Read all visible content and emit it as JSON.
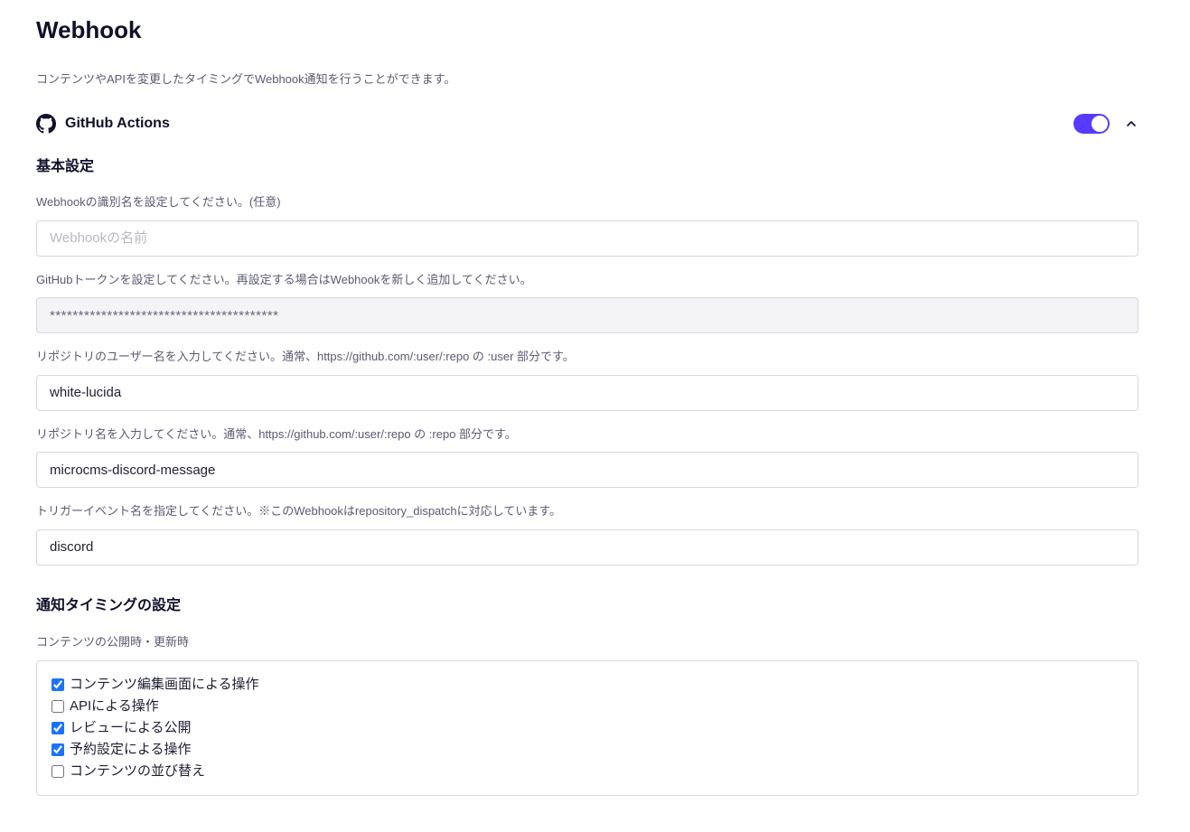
{
  "page": {
    "title": "Webhook",
    "description": "コンテンツやAPIを変更したタイミングでWebhook通知を行うことができます。"
  },
  "integration": {
    "name": "GitHub Actions",
    "enabled": true
  },
  "basic": {
    "title": "基本設定",
    "fields": {
      "name": {
        "label": "Webhookの識別名を設定してください。(任意)",
        "placeholder": "Webhookの名前",
        "value": ""
      },
      "token": {
        "label": "GitHubトークンを設定してください。再設定する場合はWebhookを新しく追加してください。",
        "value": "****************************************"
      },
      "user": {
        "label": "リポジトリのユーザー名を入力してください。通常、https://github.com/:user/:repo の :user 部分です。",
        "value": "white-lucida"
      },
      "repo": {
        "label": "リポジトリ名を入力してください。通常、https://github.com/:user/:repo の :repo 部分です。",
        "value": "microcms-discord-message"
      },
      "event": {
        "label": "トリガーイベント名を指定してください。※このWebhookはrepository_dispatchに対応しています。",
        "value": "discord"
      }
    }
  },
  "timing": {
    "title": "通知タイミングの設定",
    "group_label": "コンテンツの公開時・更新時",
    "items": [
      {
        "label": "コンテンツ編集画面による操作",
        "checked": true
      },
      {
        "label": "APIによる操作",
        "checked": false
      },
      {
        "label": "レビューによる公開",
        "checked": true
      },
      {
        "label": "予約設定による操作",
        "checked": true
      },
      {
        "label": "コンテンツの並び替え",
        "checked": false
      }
    ]
  }
}
